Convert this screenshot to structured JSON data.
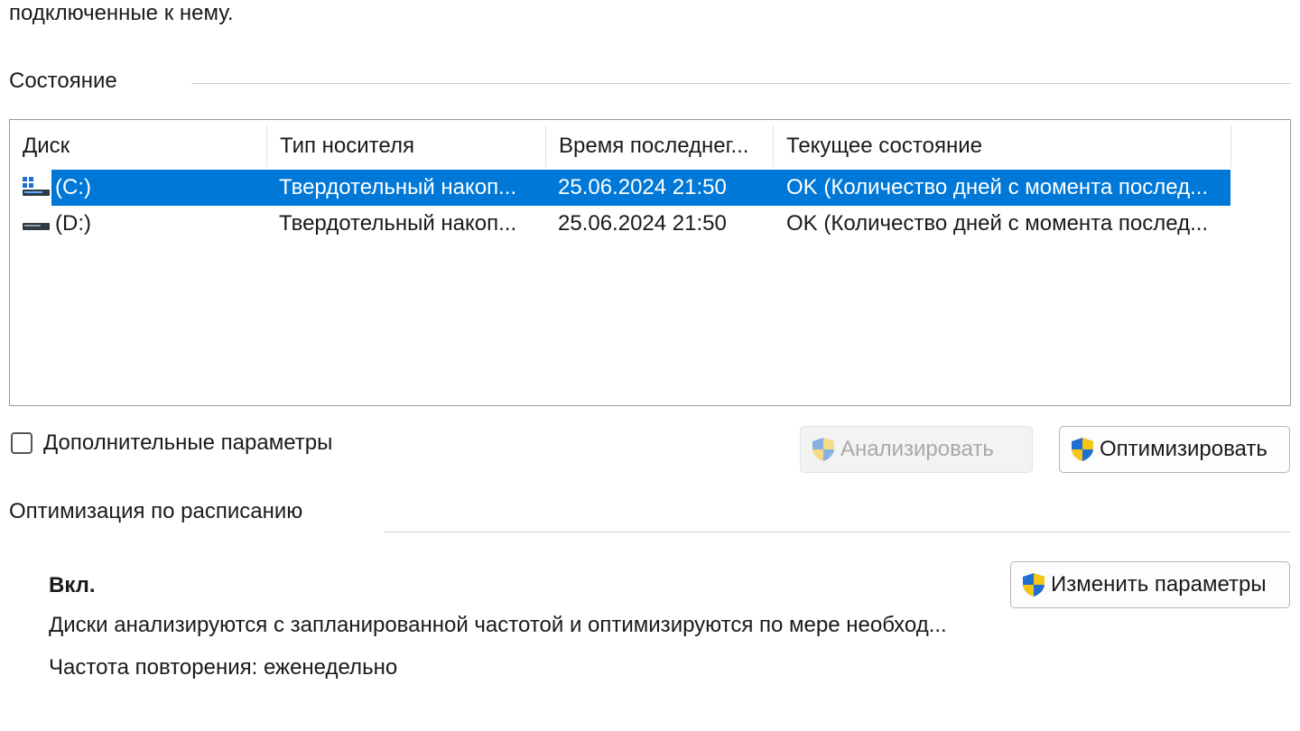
{
  "intro_text": "подключенные к нему.",
  "status_section": {
    "label": "Состояние"
  },
  "table": {
    "columns": [
      "Диск",
      "Тип носителя",
      "Время последнег...",
      "Текущее состояние"
    ],
    "rows": [
      {
        "disk": "(C:)",
        "media_type": "Твердотельный накоп...",
        "last_time": "25.06.2024 21:50",
        "state": "OK (Количество дней с момента послед...",
        "selected": true,
        "icon": "system-drive-icon"
      },
      {
        "disk": "(D:)",
        "media_type": "Твердотельный накоп...",
        "last_time": "25.06.2024 21:50",
        "state": "OK (Количество дней с момента послед...",
        "selected": false,
        "icon": "drive-icon"
      }
    ]
  },
  "advanced_checkbox": {
    "label": "Дополнительные параметры",
    "checked": false
  },
  "buttons": {
    "analyze": "Анализировать",
    "optimize": "Оптимизировать",
    "change_settings": "Изменить параметры"
  },
  "schedule_section": {
    "label": "Оптимизация по расписанию",
    "status": "Вкл.",
    "description": "Диски анализируются с запланированной частотой и оптимизируются по мере необход...",
    "frequency": "Частота повторения: еженедельно"
  },
  "colors": {
    "selection": "#0078d7",
    "shield_blue": "#1f6fd1",
    "shield_yellow": "#f5c518"
  }
}
